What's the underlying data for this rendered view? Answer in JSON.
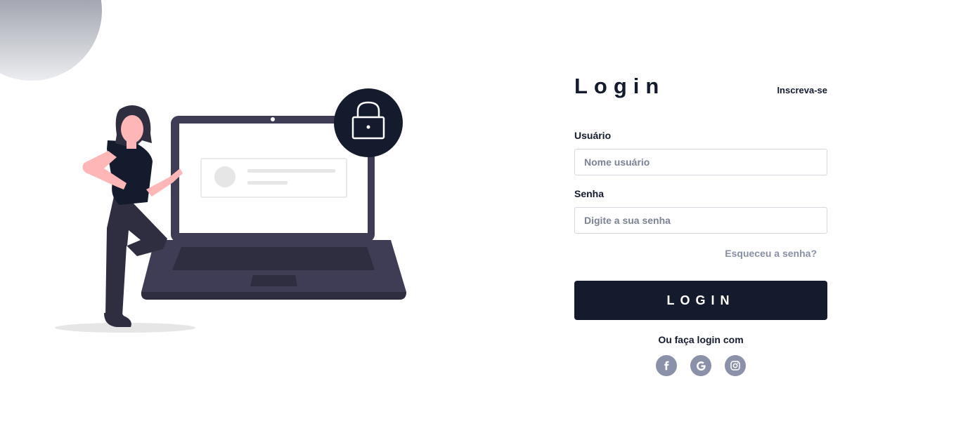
{
  "login": {
    "title": "Login",
    "signup_link": "Inscreva-se",
    "username_label": "Usuário",
    "username_placeholder": "Nome usuário",
    "password_label": "Senha",
    "password_placeholder": "Digite a sua senha",
    "forgot_link": "Esqueceu a senha?",
    "submit_label": "LOGIN",
    "alt_login_text": "Ou faça login com"
  },
  "social": [
    {
      "name": "facebook",
      "icon": "facebook-icon"
    },
    {
      "name": "google",
      "icon": "google-icon"
    },
    {
      "name": "instagram",
      "icon": "instagram-icon"
    }
  ],
  "colors": {
    "primary": "#141b2d",
    "muted": "#8a91a6",
    "social_bg": "#8a91a8",
    "laptop": "#3f3d56",
    "skin": "#ffb6b6"
  }
}
